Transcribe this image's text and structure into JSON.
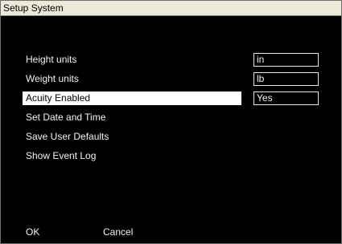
{
  "window": {
    "title": "Setup System"
  },
  "menu": {
    "items": [
      {
        "label": "Height units",
        "value": "in",
        "selected": false
      },
      {
        "label": "Weight units",
        "value": "lb",
        "selected": false
      },
      {
        "label": "Acuity Enabled",
        "value": "Yes",
        "selected": true
      },
      {
        "label": "Set Date and Time"
      },
      {
        "label": "Save User Defaults"
      },
      {
        "label": "Show Event Log"
      }
    ]
  },
  "footer": {
    "ok_label": "OK",
    "cancel_label": "Cancel"
  },
  "colors": {
    "background": "#000000",
    "text": "#f2f2f2",
    "selected_background": "#ffffff",
    "selected_text": "#000000",
    "title_bar": "#ece9d8"
  }
}
